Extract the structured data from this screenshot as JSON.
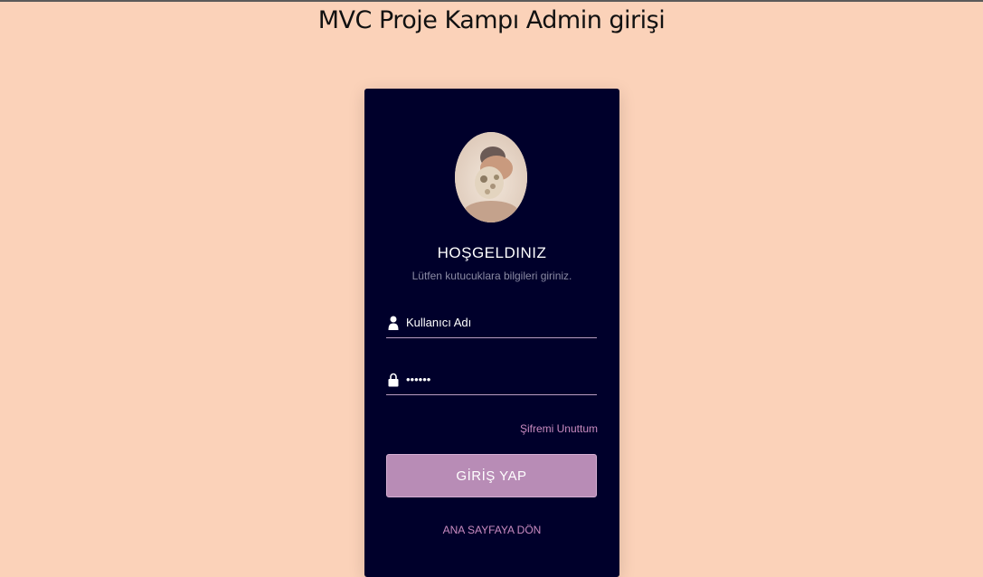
{
  "page": {
    "title": "MVC Proje Kampı Admin girişi"
  },
  "card": {
    "welcome": "HOŞGELDINIZ",
    "subtitle": "Lütfen kutucuklara bilgileri giriniz."
  },
  "form": {
    "username": {
      "placeholder": "Kullanıcı Adı",
      "icon": "user-icon"
    },
    "password": {
      "value": "******",
      "icon": "lock-icon"
    },
    "forgot_label": "Şifremi Unuttum",
    "submit_label": "GİRİŞ YAP",
    "home_label": "ANA SAYFAYA DÖN"
  },
  "colors": {
    "background": "#fbd2b9",
    "card": "#00002b",
    "accent": "#b88cb6",
    "link": "#c98bc0"
  }
}
